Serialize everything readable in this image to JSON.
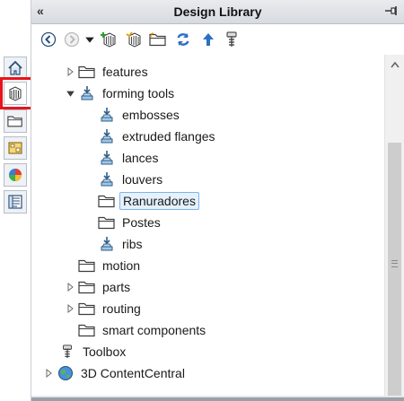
{
  "header": {
    "title": "Design Library",
    "collapse_glyph": "«"
  },
  "side_tabs": [
    {
      "icon": "home-icon"
    },
    {
      "icon": "design-library-icon",
      "selected": true
    },
    {
      "icon": "file-explorer-icon"
    },
    {
      "icon": "view-palette-icon"
    },
    {
      "icon": "appearances-icon"
    },
    {
      "icon": "custom-properties-icon"
    }
  ],
  "toolbar": {
    "buttons": [
      "back-icon",
      "forward-icon",
      "history-dropdown-icon",
      "add-to-library-icon",
      "add-file-location-icon",
      "create-new-folder-icon",
      "refresh-icon",
      "up-one-level-icon",
      "toolbox-icon"
    ]
  },
  "tree": {
    "items": [
      {
        "label": "features",
        "icon": "folder"
      },
      {
        "label": "forming tools",
        "icon": "forming-tool"
      },
      {
        "label": "embosses",
        "icon": "forming-tool"
      },
      {
        "label": "extruded flanges",
        "icon": "forming-tool"
      },
      {
        "label": "lances",
        "icon": "forming-tool"
      },
      {
        "label": "louvers",
        "icon": "forming-tool"
      },
      {
        "label": "Ranuradores",
        "icon": "folder",
        "selected": true
      },
      {
        "label": "Postes",
        "icon": "folder"
      },
      {
        "label": "ribs",
        "icon": "forming-tool"
      },
      {
        "label": "motion",
        "icon": "folder"
      },
      {
        "label": "parts",
        "icon": "folder"
      },
      {
        "label": "routing",
        "icon": "folder"
      },
      {
        "label": "smart components",
        "icon": "folder"
      },
      {
        "label": "Toolbox",
        "icon": "toolbox"
      },
      {
        "label": "3D ContentCentral",
        "icon": "globe"
      }
    ]
  },
  "colors": {
    "highlight_border": "#e8141b",
    "selection_bg": "#e5f1fb",
    "selection_border": "#7ab4e8"
  }
}
